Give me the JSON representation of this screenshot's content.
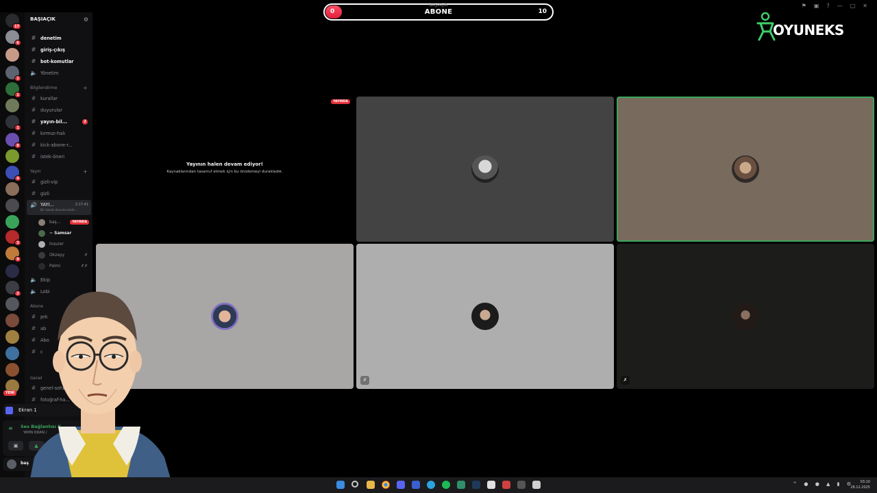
{
  "server": {
    "name": "BAŞIAÇIK"
  },
  "categories": {
    "bilgilendirme": "Bilgilendirme",
    "yayin": "Yayın",
    "abone": "Abone",
    "genel": "Genel"
  },
  "channels": {
    "c1": "denetim",
    "c2": "giriş-çıkış",
    "c3": "bot-komutlar",
    "c4": "Yönetim",
    "c5": "kurallar",
    "c6": "duyurular",
    "c7": "yayın-bil...",
    "c7_unread": "2",
    "c8": "kırmızı-halı",
    "c9": "kick-abone-r...",
    "c10": "istek-öneri",
    "c11": "gizli-vip",
    "c12": "gizli",
    "active": "YAYI...",
    "active_time": "2:17:41",
    "active_sub": "Bir kanal durumu belir...",
    "c13": "Ekip",
    "c14": "Lobi",
    "c15": "prk",
    "c16": "ab",
    "c17": "Abo",
    "c18": "c",
    "c19": "genel-sohb...",
    "c20": "fotoğraf-ha..."
  },
  "members": [
    {
      "name": "baş...",
      "live": "YAYINDA"
    },
    {
      "name": "~ Samsar"
    },
    {
      "name": "lnsurer"
    },
    {
      "name": "Okzayy"
    },
    {
      "name": "Palmi"
    }
  ],
  "rail_badges": [
    "17",
    "6",
    "1",
    "1",
    "1",
    "8",
    "4",
    "3",
    "9",
    "2"
  ],
  "rail_new": "YENİ",
  "panel": {
    "screen": "Ekran 1",
    "connection": "Ses Bağlantısı K",
    "room": "YAYIN ODASI /",
    "username": "baş"
  },
  "goal": {
    "caption": "BAŞIAÇIK",
    "label": "ABONE",
    "current": "0",
    "target": "10",
    "progress_fraction": 0.0
  },
  "brand": {
    "name": "OYUNEKS",
    "color": "#3fd06a"
  },
  "stream": {
    "live_badge": "YAYINDA",
    "title": "Yayının halen devam ediyor!",
    "subtitle": "Kaynaklarından tasarruf etmek için bu önizlemeyi durakladık."
  },
  "tiles": [
    {
      "name": "tile-user-1",
      "bg": "#434343"
    },
    {
      "name": "tile-user-2",
      "bg": "#786a5d"
    },
    {
      "name": "tile-user-3",
      "bg": "#a9a6a6"
    },
    {
      "name": "tile-user-4",
      "bg": "#aeaeae"
    },
    {
      "name": "tile-user-5",
      "bg": "#1c1d1a"
    }
  ],
  "clock": {
    "time": "03:10",
    "date": "28.12.2025"
  },
  "colors": {
    "live": "#e4323a",
    "speaking": "#3ba55d",
    "discord_bg": "#101012"
  }
}
